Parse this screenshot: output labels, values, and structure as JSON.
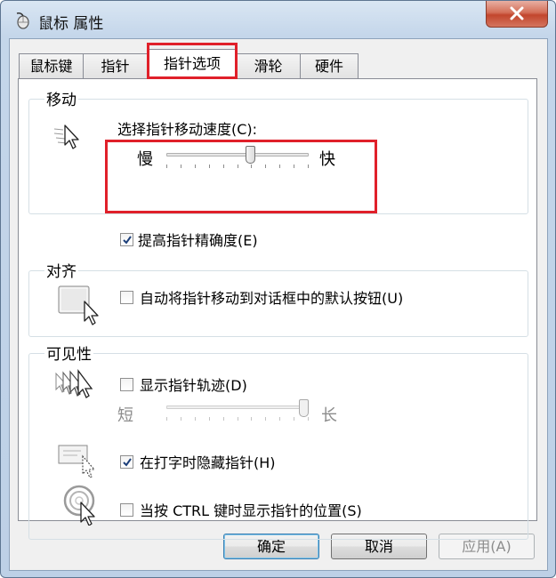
{
  "window": {
    "title": "鼠标 属性"
  },
  "tabs": [
    {
      "label": "鼠标键"
    },
    {
      "label": "指针"
    },
    {
      "label": "指针选项"
    },
    {
      "label": "滑轮"
    },
    {
      "label": "硬件"
    }
  ],
  "motion": {
    "legend": "移动",
    "speed_label": "选择指针移动速度(C):",
    "slow_label": "慢",
    "fast_label": "快",
    "speed_value": 0.6,
    "precision_label": "提高指针精确度(E)",
    "precision_checked": true
  },
  "snap": {
    "legend": "对齐",
    "snap_label": "自动将指针移动到对话框中的默认按钮(U)",
    "snap_checked": false
  },
  "visibility": {
    "legend": "可见性",
    "trails_label": "显示指针轨迹(D)",
    "trails_checked": false,
    "short_label": "短",
    "long_label": "长",
    "trails_value": 1.0,
    "hide_typing_label": "在打字时隐藏指针(H)",
    "hide_typing_checked": true,
    "ctrl_label": "当按 CTRL 键时显示指针的位置(S)",
    "ctrl_checked": false
  },
  "buttons": {
    "ok": "确定",
    "cancel": "取消",
    "apply": "应用(A)"
  },
  "colors": {
    "highlight": "#e0202a",
    "title_close": "#c2462d",
    "accent": "#3c7fb1"
  }
}
